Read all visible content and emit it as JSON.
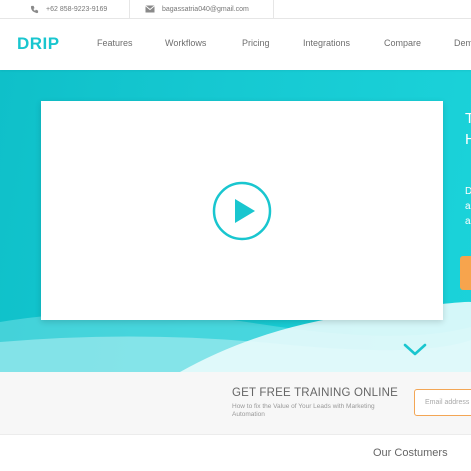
{
  "contact": {
    "phone": "+62 858-9223-9169",
    "email": "bagassatria040@gmail.com",
    "phone_icon": "phone-icon",
    "email_icon": "envelope-icon"
  },
  "nav": {
    "logo": "DRIP",
    "links": [
      "Features",
      "Workflows",
      "Pricing",
      "Integrations",
      "Compare",
      "Dem"
    ]
  },
  "hero": {
    "side_heading_lines": [
      "T",
      "H"
    ],
    "side_text_lines": [
      "D",
      "a",
      "a"
    ],
    "play_icon": "play-icon",
    "scroll_icon": "chevron-down-icon"
  },
  "training": {
    "title": "GET FREE TRAINING ONLINE",
    "subtitle": "How to fix the Value of Your Leads with Marketing Automation",
    "email_placeholder": "Email address"
  },
  "customers": {
    "title": "Our Costumers"
  },
  "colors": {
    "brand": "#19c6cf",
    "accent": "#f3a655",
    "hero_bg": "#16c9d2"
  }
}
